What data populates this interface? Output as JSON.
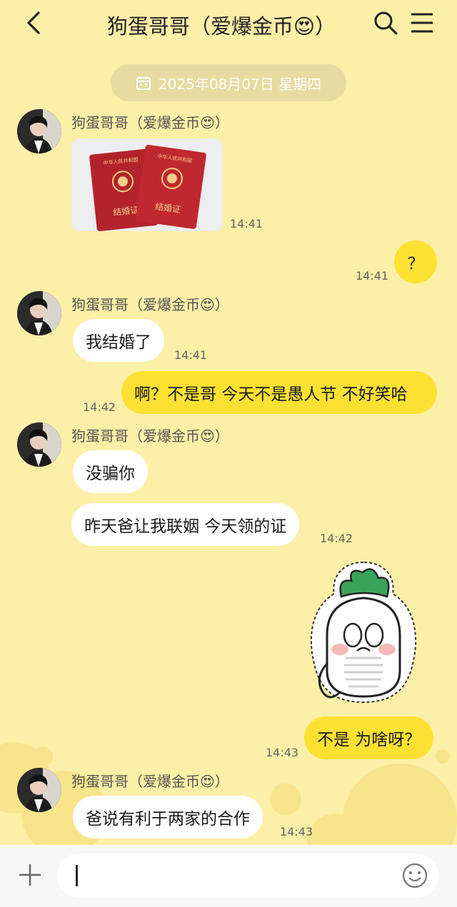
{
  "header": {
    "title": "狗蛋哥哥（爱爆金币😍）"
  },
  "date_divider": {
    "text": "2025年08月07日 星期四"
  },
  "messages": [
    {
      "side": "left",
      "sender": "狗蛋哥哥（爱爆金币😍）",
      "type": "image",
      "image_label_1": "中华人民共和国",
      "image_label_2": "结婚证",
      "time": "14:41"
    },
    {
      "side": "right",
      "type": "text",
      "text": "？",
      "time": "14:41"
    },
    {
      "side": "left",
      "sender": "狗蛋哥哥（爱爆金币😍）",
      "type": "text",
      "text": "我结婚了",
      "time": "14:41"
    },
    {
      "side": "right",
      "type": "text",
      "text": "啊？不是哥 今天不是愚人节 不好笑哈",
      "time": "14:42"
    },
    {
      "side": "left",
      "sender": "狗蛋哥哥（爱爆金币😍）",
      "type": "text",
      "text": "没骗你"
    },
    {
      "side": "left",
      "type": "text",
      "text": "昨天爸让我联姻 今天领的证",
      "time": "14:42"
    },
    {
      "side": "right",
      "type": "sticker",
      "sticker": "radish-sticker"
    },
    {
      "side": "right",
      "type": "text",
      "text": "不是 为啥呀？",
      "time": "14:43"
    },
    {
      "side": "left",
      "sender": "狗蛋哥哥（爱爆金币😍）",
      "type": "text",
      "text": "爸说有利于两家的合作",
      "time": "14:43"
    }
  ],
  "icons": {
    "back": "back-arrow-icon",
    "search": "search-icon",
    "menu": "menu-icon",
    "calendar": "calendar-icon",
    "plus": "plus-icon",
    "emoji": "emoji-icon"
  },
  "colors": {
    "background": "#fcefa7",
    "my_bubble": "#fde132",
    "their_bubble": "#ffffff",
    "date_pill": "#e7dba0"
  }
}
